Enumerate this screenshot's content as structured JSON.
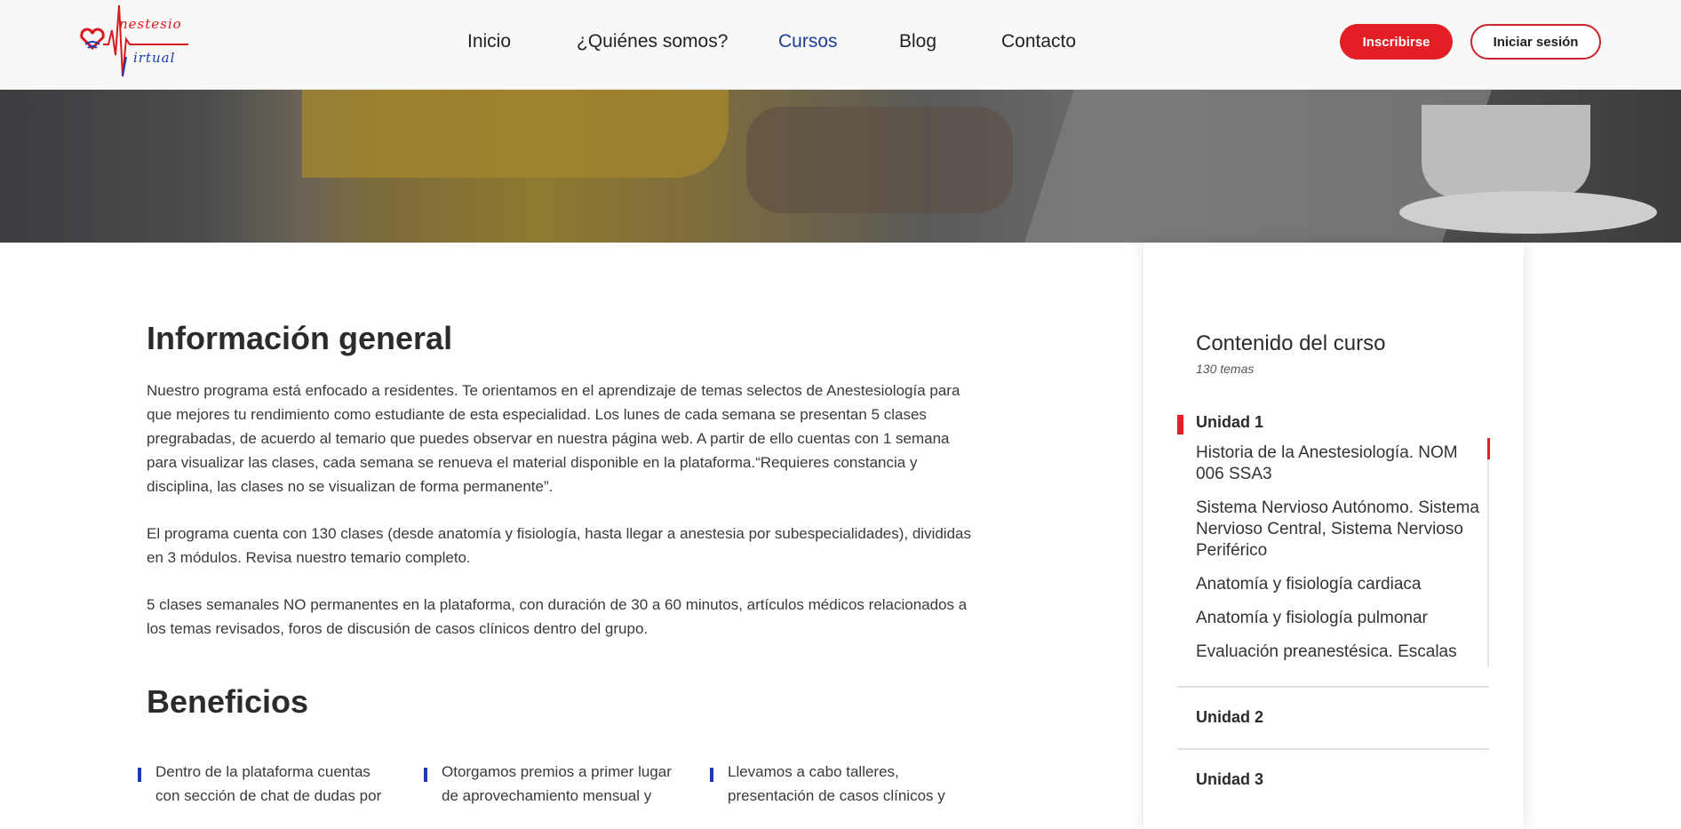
{
  "brand": {
    "logo_line1": "nestesio",
    "logo_line2": "irtual",
    "colors": {
      "primary_red": "#e31e24",
      "primary_blue": "#1a3cb0",
      "nav_active": "#1a3e98"
    }
  },
  "nav": {
    "items": [
      {
        "label": "Inicio",
        "active": false
      },
      {
        "label": "¿Quiénes somos?",
        "active": false
      },
      {
        "label": "Cursos",
        "active": true
      },
      {
        "label": "Blog",
        "active": false
      },
      {
        "label": "Contacto",
        "active": false
      }
    ]
  },
  "header": {
    "register_label": "Inscribirse",
    "login_label": "Iniciar sesión"
  },
  "main": {
    "info_title": "Información general",
    "paragraphs": [
      "Nuestro programa está enfocado a residentes. Te orientamos en el aprendizaje de temas selectos de Anestesiología para que mejores tu rendimiento como estudiante de esta especialidad. Los lunes de cada semana se presentan 5 clases pregrabadas, de acuerdo al temario que puedes observar en nuestra página web. A partir de ello cuentas con 1 semana para visualizar las clases, cada semana se renueva el material disponible en la plataforma.“Requieres constancia y disciplina, las clases no se visualizan de forma permanente”.",
      "El programa cuenta con 130 clases (desde anatomía y fisiología, hasta llegar a anestesia por subespecialidades), divididas en 3 módulos. Revisa nuestro temario completo.",
      "5 clases semanales NO permanentes en la plataforma, con duración de 30 a 60 minutos, artículos médicos relacionados a los temas revisados, foros de discusión de casos clínicos dentro del grupo."
    ],
    "benefits_title": "Beneficios",
    "benefits": [
      "Dentro de la plataforma cuentas con sección de chat de dudas por",
      "Otorgamos premios a primer lugar de aprovechamiento mensual y",
      "Llevamos a cabo talleres, presentación de casos clínicos y"
    ]
  },
  "sidebar": {
    "title": "Contenido del curso",
    "subtitle": "130 temas",
    "active_unit": "Unidad 1",
    "topics": [
      "Historia de la Anestesiología. NOM 006 SSA3",
      "Sistema Nervioso Autónomo. Sistema Nervioso Central, Sistema Nervioso Periférico",
      "Anatomía y fisiología cardiaca",
      "Anatomía y fisiología pulmonar",
      "Evaluación preanestésica. Escalas"
    ],
    "units": [
      "Unidad 2",
      "Unidad 3"
    ]
  }
}
